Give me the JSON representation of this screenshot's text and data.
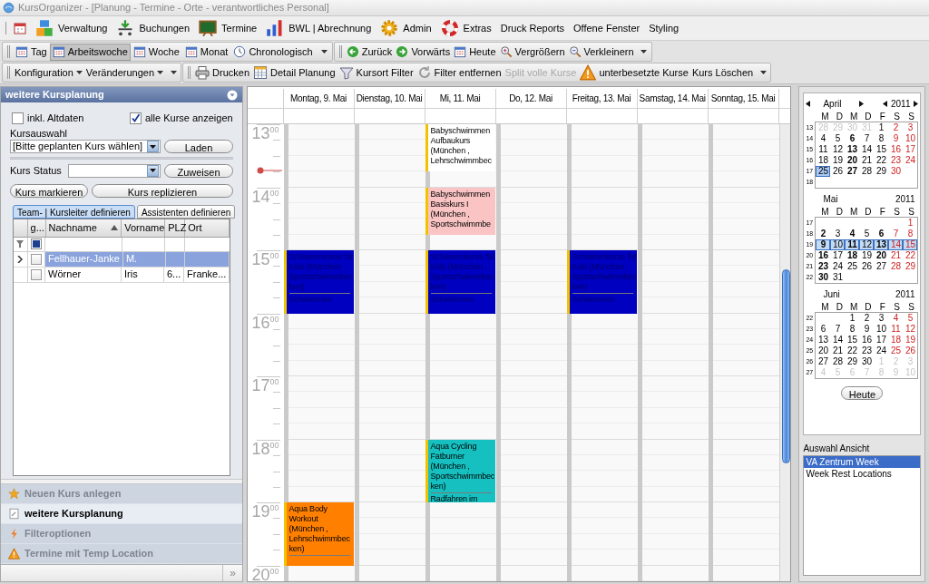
{
  "window": {
    "title": "KursOrganizer - [Planung - Termine - Orte - verantwortliches Personal]"
  },
  "menu": [
    {
      "label": "Verwaltung"
    },
    {
      "label": "Buchungen"
    },
    {
      "label": "Termine"
    },
    {
      "label": "BWL | Abrechnung"
    },
    {
      "label": "Admin"
    },
    {
      "label": "Extras"
    },
    {
      "label": "Druck Reports"
    },
    {
      "label": "Offene Fenster"
    },
    {
      "label": "Styling"
    }
  ],
  "view_toolbar": {
    "views": [
      {
        "label": "Tag",
        "selected": false,
        "kind": "button"
      },
      {
        "label": "Arbeitswoche",
        "selected": true,
        "kind": "button"
      },
      {
        "label": "Woche",
        "selected": false,
        "kind": "button"
      },
      {
        "label": "Monat",
        "selected": false,
        "kind": "button"
      },
      {
        "label": "Chronologisch",
        "selected": false,
        "kind": "dropdown"
      }
    ],
    "navigation": [
      {
        "label": "Zurück"
      },
      {
        "label": "Vorwärts"
      },
      {
        "label": "Heute"
      },
      {
        "label": "Vergrößern"
      },
      {
        "label": "Verkleinern"
      }
    ]
  },
  "action_toolbar": {
    "menus": [
      {
        "label": "Konfiguration"
      },
      {
        "label": "Veränderungen"
      }
    ],
    "actions": [
      {
        "label": "Drucken",
        "disabled": false
      },
      {
        "label": "Detail Planung",
        "disabled": false
      },
      {
        "label": "Kursort Filter",
        "disabled": false
      },
      {
        "label": "Filter entfernen",
        "disabled": false
      },
      {
        "label": "Split volle Kurse",
        "disabled": true
      },
      {
        "label": "unterbesetzte Kurse",
        "disabled": false
      },
      {
        "label": "Kurs Löschen",
        "disabled": false
      }
    ]
  },
  "planning_panel": {
    "title": "weitere Kursplanung",
    "checkboxes": [
      {
        "label": "inkl. Altdaten",
        "checked": false
      },
      {
        "label": "alle Kurse anzeigen",
        "checked": true
      }
    ],
    "course_label": "Kursauswahl",
    "course_value": "[Bitte geplanten Kurs wählen]",
    "load_button": "Laden",
    "status_label": "Kurs Status",
    "assign_button": "Zuweisen",
    "buttons": [
      "Kurs markieren",
      "Kurs replizieren"
    ],
    "tabs": [
      {
        "label": "Team- | Kursleiter definieren",
        "selected": true
      },
      {
        "label": "Assistenten definieren",
        "selected": false
      }
    ],
    "grid": {
      "columns": [
        {
          "label": "g...",
          "sorted": false
        },
        {
          "label": "Nachname",
          "sorted": true
        },
        {
          "label": "Vorname",
          "sorted": false
        },
        {
          "label": "PLZ",
          "sorted": false
        },
        {
          "label": "Ort",
          "sorted": false
        }
      ],
      "filter_checkbox": {
        "indeterminate": true
      },
      "rows": [
        {
          "selected": true,
          "checked": false,
          "nachname": "Fellhauer-Janke",
          "vorname": "M."
        },
        {
          "selected": false,
          "checked": false,
          "nachname": "Wörner",
          "vorname": "Iris",
          "plz": "6...",
          "ort": "Franke..."
        }
      ]
    }
  },
  "navigation_panel": {
    "items": [
      {
        "label": "Neuen Kurs anlegen",
        "selected": false
      },
      {
        "label": "weitere Kursplanung",
        "selected": true
      },
      {
        "label": "Filteroptionen",
        "selected": false
      },
      {
        "label": "Termine mit Temp Location",
        "selected": false
      }
    ],
    "expand_button": "»"
  },
  "calendar": {
    "days": [
      {
        "label": "Montag, 9. Mai"
      },
      {
        "label": "Dienstag, 10. Mai"
      },
      {
        "label": "Mi, 11. Mai"
      },
      {
        "label": "Do, 12. Mai"
      },
      {
        "label": "Freitag, 13. Mai"
      },
      {
        "label": "Samstag, 14. Mai"
      },
      {
        "label": "Sonntag, 15. Mai"
      }
    ],
    "hours": [
      {
        "hour": "13",
        "minutes": "00",
        "cells": [
          {
            "kind": "empty"
          },
          {
            "kind": "empty"
          },
          {
            "kind": "short",
            "title": "Babyschwimmen Aufbaukurs (München , Lehrschwimmbec",
            "color": "#ffffff"
          },
          {
            "kind": "empty"
          },
          {
            "kind": "empty"
          },
          {
            "kind": "empty"
          },
          {
            "kind": "empty"
          }
        ]
      },
      {
        "hour": "14",
        "minutes": "00",
        "cells": [
          {
            "kind": "empty"
          },
          {
            "kind": "empty"
          },
          {
            "kind": "short",
            "title": "Babyschwimmen Basiskurs I (München , Sportschwimmbe",
            "color": "#fbc4c4"
          },
          {
            "kind": "empty"
          },
          {
            "kind": "empty"
          },
          {
            "kind": "empty"
          },
          {
            "kind": "empty"
          }
        ]
      },
      {
        "hour": "15",
        "minutes": "00",
        "cells": [
          {
            "kind": "long",
            "title": "Schwimmkurse für Kids (München , Sportschwimmbecken)",
            "subtitle": "Schwimmen",
            "color": "#0000c0"
          },
          {
            "kind": "empty"
          },
          {
            "kind": "long",
            "title": "Schwimmkurse für Kids (München , Sportschwimmbecken)",
            "subtitle": "Schwimmen",
            "color": "#0000c0"
          },
          {
            "kind": "empty"
          },
          {
            "kind": "long",
            "title": "Schwimmkurse für Kids (München , Sportschwimmbecken)",
            "subtitle": "Schwimmen",
            "color": "#0000c0"
          },
          {
            "kind": "empty"
          },
          {
            "kind": "empty"
          }
        ]
      },
      {
        "hour": "16",
        "minutes": "00",
        "cells": [
          {
            "kind": "empty"
          },
          {
            "kind": "empty"
          },
          {
            "kind": "empty"
          },
          {
            "kind": "empty"
          },
          {
            "kind": "empty"
          },
          {
            "kind": "empty"
          },
          {
            "kind": "empty"
          }
        ]
      },
      {
        "hour": "17",
        "minutes": "00",
        "cells": [
          {
            "kind": "empty"
          },
          {
            "kind": "empty"
          },
          {
            "kind": "empty"
          },
          {
            "kind": "empty"
          },
          {
            "kind": "empty"
          },
          {
            "kind": "empty"
          },
          {
            "kind": "empty"
          }
        ]
      },
      {
        "hour": "18",
        "minutes": "00",
        "cells": [
          {
            "kind": "empty"
          },
          {
            "kind": "empty"
          },
          {
            "kind": "long",
            "title": "Aqua Cycling Fatburner (München , Sportschwimmbecken)",
            "subtitle": "Radfahren im",
            "color": "#16c0c0"
          },
          {
            "kind": "empty"
          },
          {
            "kind": "empty"
          },
          {
            "kind": "empty"
          },
          {
            "kind": "empty"
          }
        ]
      },
      {
        "hour": "19",
        "minutes": "00",
        "cells": [
          {
            "kind": "long",
            "title": "Aqua Body Workout (München , Lehrschwimmbecken)",
            "color": "#ff8000"
          },
          {
            "kind": "empty"
          },
          {
            "kind": "empty"
          },
          {
            "kind": "empty"
          },
          {
            "kind": "empty"
          },
          {
            "kind": "empty"
          },
          {
            "kind": "empty"
          }
        ]
      },
      {
        "hour": "20",
        "minutes": "00",
        "cells": [
          {
            "kind": "empty"
          },
          {
            "kind": "empty"
          },
          {
            "kind": "empty"
          },
          {
            "kind": "empty"
          },
          {
            "kind": "empty"
          },
          {
            "kind": "empty"
          },
          {
            "kind": "empty"
          }
        ]
      }
    ]
  },
  "mini_calendar": {
    "months": [
      {
        "month": "April",
        "year": "2011",
        "navigation": true,
        "weekdays": [
          "M",
          "D",
          "M",
          "D",
          "F",
          "S",
          "S"
        ],
        "weeks": [
          {
            "number": "13",
            "selected": false,
            "days": [
              {
                "d": "28",
                "kind": "out"
              },
              {
                "d": "29",
                "kind": "out"
              },
              {
                "d": "30",
                "kind": "out"
              },
              {
                "d": "31",
                "kind": "out"
              },
              {
                "d": "1",
                "kind": "plain"
              },
              {
                "d": "2",
                "kind": "plain"
              },
              {
                "d": "3",
                "kind": "plain"
              }
            ]
          },
          {
            "number": "14",
            "selected": false,
            "days": [
              {
                "d": "4",
                "kind": "plain"
              },
              {
                "d": "5",
                "kind": "plain"
              },
              {
                "d": "6",
                "kind": "bold"
              },
              {
                "d": "7",
                "kind": "plain"
              },
              {
                "d": "8",
                "kind": "plain"
              },
              {
                "d": "9",
                "kind": "plain"
              },
              {
                "d": "10",
                "kind": "plain"
              }
            ]
          },
          {
            "number": "15",
            "selected": false,
            "days": [
              {
                "d": "11",
                "kind": "plain"
              },
              {
                "d": "12",
                "kind": "plain"
              },
              {
                "d": "13",
                "kind": "bold"
              },
              {
                "d": "14",
                "kind": "plain"
              },
              {
                "d": "15",
                "kind": "plain"
              },
              {
                "d": "16",
                "kind": "plain"
              },
              {
                "d": "17",
                "kind": "plain"
              }
            ]
          },
          {
            "number": "16",
            "selected": false,
            "days": [
              {
                "d": "18",
                "kind": "plain"
              },
              {
                "d": "19",
                "kind": "plain"
              },
              {
                "d": "20",
                "kind": "bold"
              },
              {
                "d": "21",
                "kind": "plain"
              },
              {
                "d": "22",
                "kind": "plain"
              },
              {
                "d": "23",
                "kind": "plain"
              },
              {
                "d": "24",
                "kind": "plain"
              }
            ]
          },
          {
            "number": "17",
            "selected": false,
            "days": [
              {
                "d": "25",
                "kind": "today"
              },
              {
                "d": "26",
                "kind": "plain"
              },
              {
                "d": "27",
                "kind": "bold"
              },
              {
                "d": "28",
                "kind": "plain"
              },
              {
                "d": "29",
                "kind": "plain"
              },
              {
                "d": "30",
                "kind": "plain"
              },
              {
                "kind": "blank"
              }
            ]
          },
          {
            "number": "18",
            "selected": false,
            "days": [
              {
                "kind": "blank"
              },
              {
                "kind": "blank"
              },
              {
                "kind": "blank"
              },
              {
                "kind": "blank"
              },
              {
                "kind": "blank"
              },
              {
                "kind": "blank"
              },
              {
                "kind": "blank"
              }
            ]
          }
        ]
      },
      {
        "month": "Mai",
        "year": "2011",
        "navigation": false,
        "weekdays": [
          "M",
          "D",
          "M",
          "D",
          "F",
          "S",
          "S"
        ],
        "weeks": [
          {
            "number": "17",
            "selected": false,
            "days": [
              {
                "kind": "blank"
              },
              {
                "kind": "blank"
              },
              {
                "kind": "blank"
              },
              {
                "kind": "blank"
              },
              {
                "kind": "blank"
              },
              {
                "kind": "blank"
              },
              {
                "d": "1",
                "kind": "plain"
              }
            ]
          },
          {
            "number": "18",
            "selected": false,
            "days": [
              {
                "d": "2",
                "kind": "bold"
              },
              {
                "d": "3",
                "kind": "plain"
              },
              {
                "d": "4",
                "kind": "bold"
              },
              {
                "d": "5",
                "kind": "plain"
              },
              {
                "d": "6",
                "kind": "bold"
              },
              {
                "d": "7",
                "kind": "plain"
              },
              {
                "d": "8",
                "kind": "plain"
              }
            ]
          },
          {
            "number": "19",
            "selected": true,
            "days": [
              {
                "d": "9",
                "kind": "bold"
              },
              {
                "d": "10",
                "kind": "plain"
              },
              {
                "d": "11",
                "kind": "bold"
              },
              {
                "d": "12",
                "kind": "plain"
              },
              {
                "d": "13",
                "kind": "bold"
              },
              {
                "d": "14",
                "kind": "plain"
              },
              {
                "d": "15",
                "kind": "plain"
              }
            ]
          },
          {
            "number": "20",
            "selected": false,
            "days": [
              {
                "d": "16",
                "kind": "bold"
              },
              {
                "d": "17",
                "kind": "plain"
              },
              {
                "d": "18",
                "kind": "bold"
              },
              {
                "d": "19",
                "kind": "plain"
              },
              {
                "d": "20",
                "kind": "bold"
              },
              {
                "d": "21",
                "kind": "plain"
              },
              {
                "d": "22",
                "kind": "plain"
              }
            ]
          },
          {
            "number": "21",
            "selected": false,
            "days": [
              {
                "d": "23",
                "kind": "bold"
              },
              {
                "d": "24",
                "kind": "plain"
              },
              {
                "d": "25",
                "kind": "plain"
              },
              {
                "d": "26",
                "kind": "plain"
              },
              {
                "d": "27",
                "kind": "plain"
              },
              {
                "d": "28",
                "kind": "plain"
              },
              {
                "d": "29",
                "kind": "plain"
              }
            ]
          },
          {
            "number": "22",
            "selected": false,
            "days": [
              {
                "d": "30",
                "kind": "bold"
              },
              {
                "d": "31",
                "kind": "plain"
              },
              {
                "kind": "blank"
              },
              {
                "kind": "blank"
              },
              {
                "kind": "blank"
              },
              {
                "kind": "blank"
              },
              {
                "kind": "blank"
              }
            ]
          }
        ]
      },
      {
        "month": "Juni",
        "year": "2011",
        "navigation": false,
        "weekdays": [
          "M",
          "D",
          "M",
          "D",
          "F",
          "S",
          "S"
        ],
        "weeks": [
          {
            "number": "22",
            "selected": false,
            "days": [
              {
                "kind": "blank"
              },
              {
                "kind": "blank"
              },
              {
                "d": "1",
                "kind": "plain"
              },
              {
                "d": "2",
                "kind": "plain"
              },
              {
                "d": "3",
                "kind": "plain"
              },
              {
                "d": "4",
                "kind": "plain"
              },
              {
                "d": "5",
                "kind": "plain"
              }
            ]
          },
          {
            "number": "23",
            "selected": false,
            "days": [
              {
                "d": "6",
                "kind": "plain"
              },
              {
                "d": "7",
                "kind": "plain"
              },
              {
                "d": "8",
                "kind": "plain"
              },
              {
                "d": "9",
                "kind": "plain"
              },
              {
                "d": "10",
                "kind": "plain"
              },
              {
                "d": "11",
                "kind": "plain"
              },
              {
                "d": "12",
                "kind": "plain"
              }
            ]
          },
          {
            "number": "24",
            "selected": false,
            "days": [
              {
                "d": "13",
                "kind": "plain"
              },
              {
                "d": "14",
                "kind": "plain"
              },
              {
                "d": "15",
                "kind": "plain"
              },
              {
                "d": "16",
                "kind": "plain"
              },
              {
                "d": "17",
                "kind": "plain"
              },
              {
                "d": "18",
                "kind": "plain"
              },
              {
                "d": "19",
                "kind": "plain"
              }
            ]
          },
          {
            "number": "25",
            "selected": false,
            "days": [
              {
                "d": "20",
                "kind": "plain"
              },
              {
                "d": "21",
                "kind": "plain"
              },
              {
                "d": "22",
                "kind": "plain"
              },
              {
                "d": "23",
                "kind": "plain"
              },
              {
                "d": "24",
                "kind": "plain"
              },
              {
                "d": "25",
                "kind": "plain"
              },
              {
                "d": "26",
                "kind": "plain"
              }
            ]
          },
          {
            "number": "26",
            "selected": false,
            "days": [
              {
                "d": "27",
                "kind": "plain"
              },
              {
                "d": "28",
                "kind": "plain"
              },
              {
                "d": "29",
                "kind": "plain"
              },
              {
                "d": "30",
                "kind": "plain"
              },
              {
                "d": "1",
                "kind": "out"
              },
              {
                "d": "2",
                "kind": "out"
              },
              {
                "d": "3",
                "kind": "out"
              }
            ]
          },
          {
            "number": "27",
            "selected": false,
            "days": [
              {
                "d": "4",
                "kind": "out"
              },
              {
                "d": "5",
                "kind": "out"
              },
              {
                "d": "6",
                "kind": "out"
              },
              {
                "d": "7",
                "kind": "out"
              },
              {
                "d": "8",
                "kind": "out"
              },
              {
                "d": "9",
                "kind": "out"
              },
              {
                "d": "10",
                "kind": "out"
              }
            ]
          }
        ]
      }
    ],
    "today_button": "Heute"
  },
  "view_selection": {
    "label": "Auswahl Ansicht",
    "items": [
      {
        "label": "VA Zentrum Week",
        "selected": true
      },
      {
        "label": "Week Rest Locations",
        "selected": false
      }
    ]
  }
}
